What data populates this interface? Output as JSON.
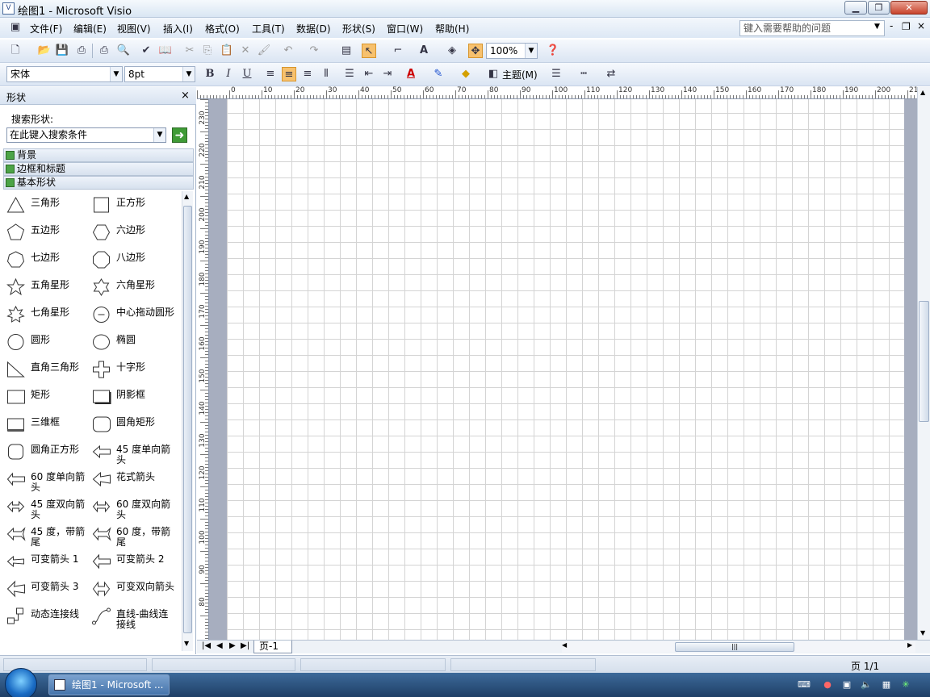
{
  "window": {
    "title": "绘图1 - Microsoft Visio",
    "app_icon_glyph": "V",
    "buttons": {
      "minimize": "▁",
      "restore": "❐",
      "close": "✕"
    }
  },
  "menu": {
    "items": [
      "文件(F)",
      "编辑(E)",
      "视图(V)",
      "插入(I)",
      "格式(O)",
      "工具(T)",
      "数据(D)",
      "形状(S)",
      "窗口(W)",
      "帮助(H)"
    ],
    "help_placeholder": "键入需要帮助的问题",
    "doc_controls": [
      "-",
      "❐",
      "×"
    ]
  },
  "toolbar_standard": {
    "zoom": "100%"
  },
  "toolbar_formatting": {
    "font": "宋体",
    "font_size": "8pt",
    "bold": "B",
    "italic": "I",
    "underline": "U",
    "theme": "主题(M)"
  },
  "shapes_panel": {
    "title": "形状",
    "close_glyph": "×",
    "search_label": "搜索形状:",
    "search_placeholder": "在此键入搜索条件",
    "stencils": [
      "背景",
      "边框和标题",
      "基本形状"
    ],
    "shapes": [
      {
        "label": "三角形",
        "icon": "triangle-icon"
      },
      {
        "label": "正方形",
        "icon": "square-icon"
      },
      {
        "label": "五边形",
        "icon": "pentagon-icon"
      },
      {
        "label": "六边形",
        "icon": "hexagon-icon"
      },
      {
        "label": "七边形",
        "icon": "heptagon-icon"
      },
      {
        "label": "八边形",
        "icon": "octagon-icon"
      },
      {
        "label": "五角星形",
        "icon": "star5-icon"
      },
      {
        "label": "六角星形",
        "icon": "star6-icon"
      },
      {
        "label": "七角星形",
        "icon": "star7-icon"
      },
      {
        "label": "中心拖动圆形",
        "icon": "center-circle-icon"
      },
      {
        "label": "圆形",
        "icon": "circle-icon"
      },
      {
        "label": "椭圆",
        "icon": "ellipse-icon"
      },
      {
        "label": "直角三角形",
        "icon": "right-triangle-icon"
      },
      {
        "label": "十字形",
        "icon": "cross-icon"
      },
      {
        "label": "矩形",
        "icon": "rectangle-icon"
      },
      {
        "label": "阴影框",
        "icon": "shadow-box-icon"
      },
      {
        "label": "三维框",
        "icon": "3d-box-icon"
      },
      {
        "label": "圆角矩形",
        "icon": "rounded-rectangle-icon"
      },
      {
        "label": "圆角正方形",
        "icon": "rounded-square-icon"
      },
      {
        "label": "45 度单向箭头",
        "icon": "arrow-45-icon"
      },
      {
        "label": "60 度单向箭头",
        "icon": "arrow-60-icon"
      },
      {
        "label": "花式箭头",
        "icon": "fancy-arrow-icon"
      },
      {
        "label": "45 度双向箭头",
        "icon": "double-arrow-45-icon"
      },
      {
        "label": "60 度双向箭头",
        "icon": "double-arrow-60-icon"
      },
      {
        "label": "45 度，带箭尾",
        "icon": "tail-arrow-45-icon"
      },
      {
        "label": "60 度，带箭尾",
        "icon": "tail-arrow-60-icon"
      },
      {
        "label": "可变箭头 1",
        "icon": "flexi-arrow-1-icon"
      },
      {
        "label": "可变箭头 2",
        "icon": "flexi-arrow-2-icon"
      },
      {
        "label": "可变箭头 3",
        "icon": "flexi-arrow-3-icon"
      },
      {
        "label": "可变双向箭头",
        "icon": "flexi-double-arrow-icon"
      },
      {
        "label": "动态连接线",
        "icon": "dynamic-connector-icon"
      },
      {
        "label": "直线-曲线连接线",
        "icon": "line-curve-connector-icon"
      }
    ]
  },
  "rulers": {
    "horizontal": [
      "0",
      "10",
      "20",
      "30",
      "40",
      "50",
      "60",
      "70",
      "80",
      "90",
      "100",
      "110",
      "120",
      "130",
      "140",
      "150",
      "160",
      "170",
      "180",
      "190",
      "200",
      "21"
    ],
    "vertical": [
      "230",
      "220",
      "210",
      "200",
      "190",
      "180",
      "170",
      "160",
      "150",
      "140",
      "130",
      "120",
      "110",
      "100",
      "90",
      "80"
    ]
  },
  "page_tabs": {
    "nav": [
      "|◀",
      "◀",
      "▶",
      "▶|"
    ],
    "current": "页-1"
  },
  "status": {
    "page": "页 1/1"
  },
  "taskbar": {
    "window_button": "绘图1 - Microsoft ..."
  }
}
